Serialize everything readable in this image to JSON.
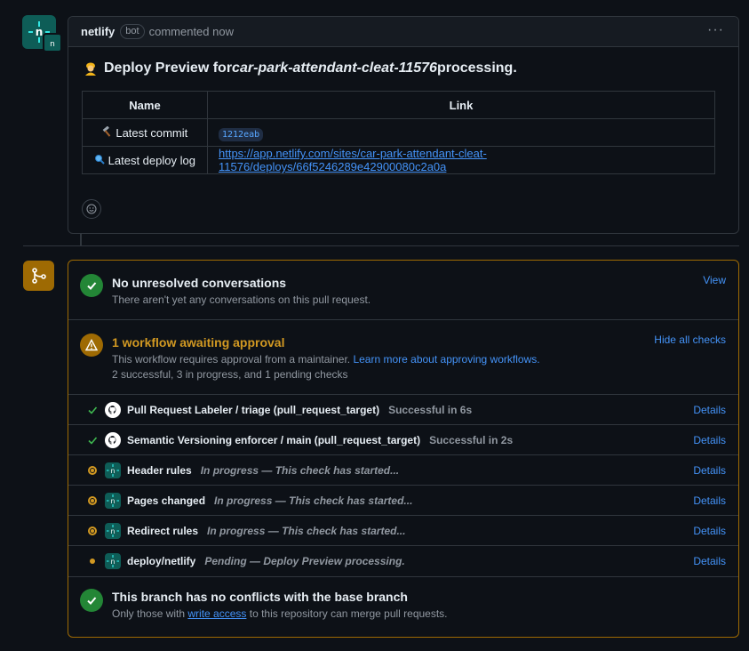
{
  "comment": {
    "author": "netlify",
    "badge": "bot",
    "time": "commented now",
    "title_prefix": "Deploy Preview for ",
    "title_site": "car-park-attendant-cleat-11576",
    "title_suffix": " processing.",
    "table": {
      "headers": [
        "Name",
        "Link"
      ],
      "rows": [
        {
          "name": "Latest commit",
          "icon": "hammer-icon",
          "value": "1212eab"
        },
        {
          "name": "Latest deploy log",
          "icon": "magnifier-icon",
          "value": "https://app.netlify.com/sites/car-park-attendant-cleat-11576/deploys/66f5246289e42900080c2a0a"
        }
      ]
    }
  },
  "conversations": {
    "title": "No unresolved conversations",
    "subtitle": "There aren't yet any conversations on this pull request.",
    "action": "View"
  },
  "workflow": {
    "title": "1 workflow awaiting approval",
    "subtitle_prefix": "This workflow requires approval from a maintainer. ",
    "subtitle_link": "Learn more about approving workflows.",
    "summary": "2 successful, 3 in progress, and 1 pending checks",
    "action": "Hide all checks"
  },
  "checks": [
    {
      "name": "Pull Request Labeler / triage (pull_request_target)",
      "desc": "Successful in 6s",
      "status": "success",
      "app": "github",
      "details": "Details"
    },
    {
      "name": "Semantic Versioning enforcer / main (pull_request_target)",
      "desc": "Successful in 2s",
      "status": "success",
      "app": "github",
      "details": "Details"
    },
    {
      "name": "Header rules",
      "desc": "In progress — This check has started...",
      "status": "in_progress",
      "app": "netlify",
      "details": "Details"
    },
    {
      "name": "Pages changed",
      "desc": "In progress — This check has started...",
      "status": "in_progress",
      "app": "netlify",
      "details": "Details"
    },
    {
      "name": "Redirect rules",
      "desc": "In progress — This check has started...",
      "status": "in_progress",
      "app": "netlify",
      "details": "Details"
    },
    {
      "name": "deploy/netlify",
      "desc": "Pending — Deploy Preview processing.",
      "status": "pending",
      "app": "netlify",
      "details": "Details"
    }
  ],
  "conflicts": {
    "title": "This branch has no conflicts with the base branch",
    "subtitle_prefix": "Only those with ",
    "subtitle_link": "write access",
    "subtitle_suffix": " to this repository can merge pull requests."
  },
  "colors": {
    "background": "#0d1117",
    "border": "#30363d",
    "success": "#238636",
    "attention": "#9e6a03",
    "link": "#4493f8",
    "netlify": "#0e5d57"
  }
}
